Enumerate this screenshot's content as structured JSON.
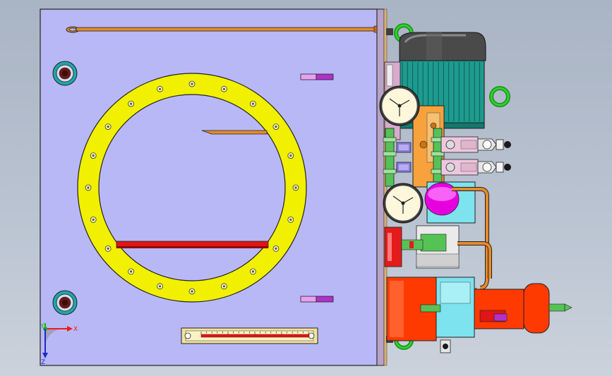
{
  "viewport": {
    "background_top": "#a9b4c4",
    "background_bottom": "#cbd2dc"
  },
  "colors": {
    "tank_plate": "#b9b8f6",
    "flange_ring": "#f1f000",
    "copper_tube": "#e48a2b",
    "red_tube": "#e01515",
    "motor_body": "#1e9b8f",
    "motor_cap": "#4a4a4a",
    "gauge_face": "#fff7dc",
    "valve_block": "#f7a23c",
    "solenoid": "#ecc7de",
    "fitting_green": "#56c256",
    "pump_magenta": "#e600e0",
    "pump_cyan": "#7ee3ee",
    "motor2_red": "#ff3a00",
    "brown_edge": "#c8a064"
  },
  "components": [
    "tank-top-plate",
    "inspection-cover-flange",
    "level-gauge",
    "lifting-eye",
    "electric-motor",
    "pressure-gauge",
    "valve-block",
    "solenoid-valve",
    "gear-pump",
    "small-motor-pump"
  ],
  "triad": {
    "x_label": "X",
    "y_label": "Y",
    "z_label": "Z",
    "x_color": "#ee1c1c",
    "y_color": "#18b418",
    "z_color": "#1c2cc8"
  }
}
